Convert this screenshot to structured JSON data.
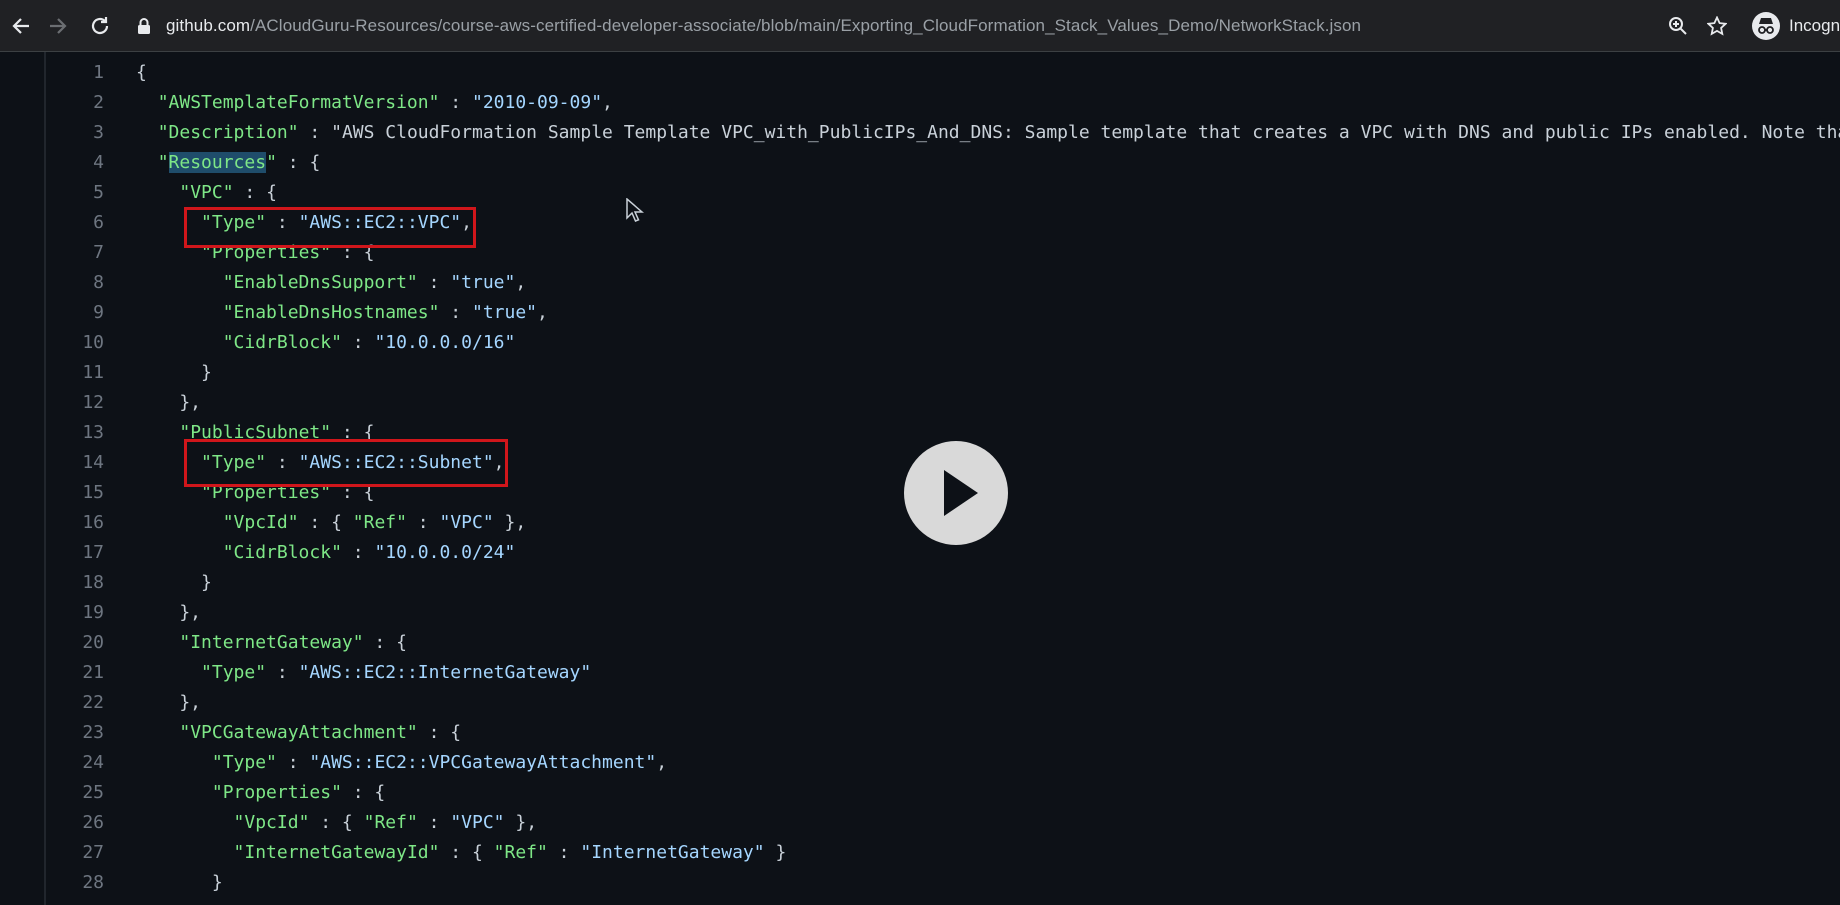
{
  "browser": {
    "url_host": "github.com",
    "url_path": "/ACloudGuru-Resources/course-aws-certified-developer-associate/blob/main/Exporting_CloudFormation_Stack_Values_Demo/NetworkStack.json",
    "profile_label": "Incogni"
  },
  "icons": [
    "back-arrow-icon",
    "forward-arrow-icon",
    "reload-icon",
    "lock-icon",
    "zoom-icon",
    "star-icon",
    "incognito-icon",
    "play-icon",
    "mouse-cursor-icon"
  ],
  "colors": {
    "key": "#7ee787",
    "string": "#a5d6ff",
    "highlight_box": "#d0161b",
    "background": "#0d1117"
  },
  "code_lines": [
    {
      "n": "1",
      "t": "{"
    },
    {
      "n": "2",
      "t": "  \"AWSTemplateFormatVersion\" : \"2010-09-09\","
    },
    {
      "n": "3",
      "t": "  \"Description\" : \"AWS CloudFormation Sample Template VPC_with_PublicIPs_And_DNS: Sample template that creates a VPC with DNS and public IPs enabled. Note tha"
    },
    {
      "n": "4",
      "t": "  \"Resources\" : {"
    },
    {
      "n": "5",
      "t": "    \"VPC\" : {"
    },
    {
      "n": "6",
      "t": "      \"Type\" : \"AWS::EC2::VPC\","
    },
    {
      "n": "7",
      "t": "      \"Properties\" : {"
    },
    {
      "n": "8",
      "t": "        \"EnableDnsSupport\" : \"true\","
    },
    {
      "n": "9",
      "t": "        \"EnableDnsHostnames\" : \"true\","
    },
    {
      "n": "10",
      "t": "        \"CidrBlock\" : \"10.0.0.0/16\""
    },
    {
      "n": "11",
      "t": "      }"
    },
    {
      "n": "12",
      "t": "    },"
    },
    {
      "n": "13",
      "t": "    \"PublicSubnet\" : {"
    },
    {
      "n": "14",
      "t": "      \"Type\" : \"AWS::EC2::Subnet\","
    },
    {
      "n": "15",
      "t": "      \"Properties\" : {"
    },
    {
      "n": "16",
      "t": "        \"VpcId\" : { \"Ref\" : \"VPC\" },"
    },
    {
      "n": "17",
      "t": "        \"CidrBlock\" : \"10.0.0.0/24\""
    },
    {
      "n": "18",
      "t": "      }"
    },
    {
      "n": "19",
      "t": "    },"
    },
    {
      "n": "20",
      "t": "    \"InternetGateway\" : {"
    },
    {
      "n": "21",
      "t": "      \"Type\" : \"AWS::EC2::InternetGateway\""
    },
    {
      "n": "22",
      "t": "    },"
    },
    {
      "n": "23",
      "t": "    \"VPCGatewayAttachment\" : {"
    },
    {
      "n": "24",
      "t": "       \"Type\" : \"AWS::EC2::VPCGatewayAttachment\","
    },
    {
      "n": "25",
      "t": "       \"Properties\" : {"
    },
    {
      "n": "26",
      "t": "         \"VpcId\" : { \"Ref\" : \"VPC\" },"
    },
    {
      "n": "27",
      "t": "         \"InternetGatewayId\" : { \"Ref\" : \"InternetGateway\" }"
    },
    {
      "n": "28",
      "t": "       }"
    }
  ],
  "highlighted_word": "Resources"
}
